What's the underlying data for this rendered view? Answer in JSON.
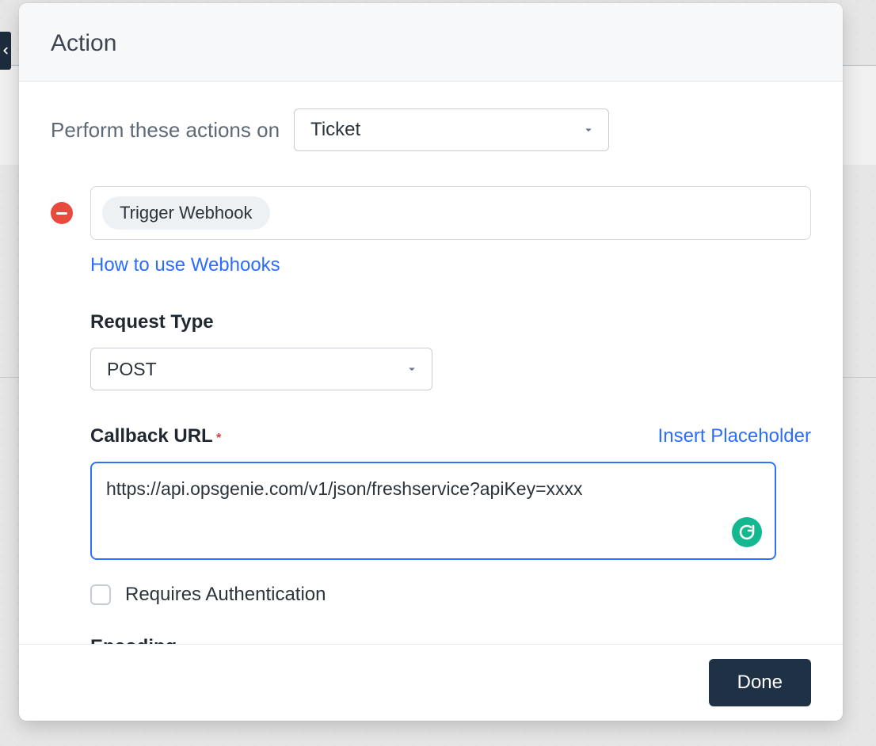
{
  "modal": {
    "title": "Action",
    "perform_label": "Perform these actions on",
    "perform_select_value": "Ticket",
    "action_chip": "Trigger Webhook",
    "how_to_link": "How to use Webhooks",
    "request_type": {
      "label": "Request Type",
      "value": "POST"
    },
    "callback_url": {
      "label": "Callback URL",
      "required_mark": "*",
      "insert_placeholder_link": "Insert Placeholder",
      "value": "https://api.opsgenie.com/v1/json/freshservice?apiKey=xxxx"
    },
    "requires_auth_label": "Requires Authentication",
    "encoding_label": "Encoding",
    "footer": {
      "done": "Done"
    }
  }
}
